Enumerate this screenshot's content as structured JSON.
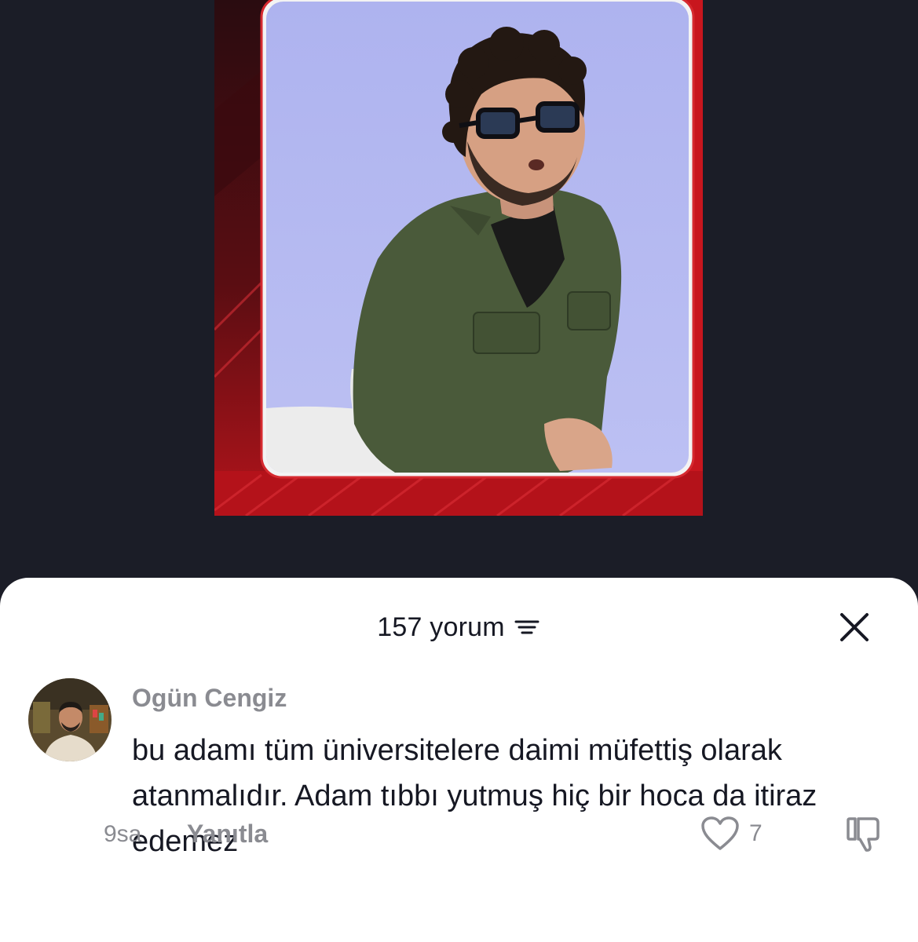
{
  "video": {
    "thumbnail_icon": "person-in-green-jacket-thumbnail"
  },
  "comments_panel": {
    "count_label": "157 yorum",
    "sort_icon": "filter-lines-icon",
    "close_icon": "close-icon"
  },
  "comment": {
    "author": "Ogün Cengiz",
    "text": "bu adamı tüm üniversitelere daimi müfettiş olarak atanmalıdır. Adam tıbbı yutmuş hiç bir hoca da itiraz edemez",
    "time": "9sa",
    "reply_label": "Yanıtla",
    "like_count": "7",
    "like_icon": "heart-icon",
    "dislike_icon": "thumbs-down-icon"
  },
  "colors": {
    "background": "#1b1d27",
    "sheet": "#ffffff",
    "muted_text": "#8a8b91",
    "primary_text": "#161823",
    "frame_red": "#c8161e",
    "photo_backdrop": "#b4b9f0"
  }
}
